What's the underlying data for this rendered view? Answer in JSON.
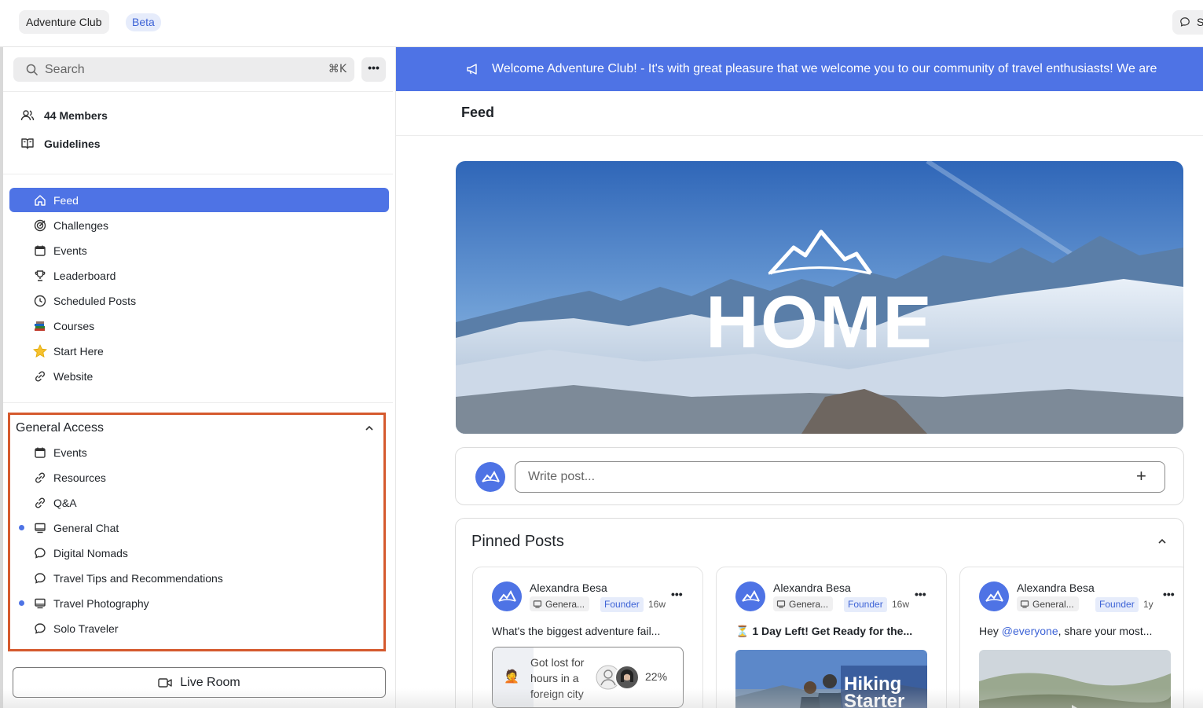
{
  "topbar": {
    "app_name": "Adventure Club",
    "badge": "Beta",
    "right_button_label": "S"
  },
  "sidebar": {
    "search_placeholder": "Search",
    "search_shortcut": "⌘K",
    "members": "44 Members",
    "guidelines": "Guidelines",
    "nav": [
      {
        "label": "Feed",
        "icon": "home-icon"
      },
      {
        "label": "Challenges",
        "icon": "target-icon"
      },
      {
        "label": "Events",
        "icon": "calendar-icon"
      },
      {
        "label": "Leaderboard",
        "icon": "trophy-icon"
      },
      {
        "label": "Scheduled Posts",
        "icon": "clock-icon"
      },
      {
        "label": "Courses",
        "icon": "books-emoji-icon"
      },
      {
        "label": "Start Here",
        "icon": "star-emoji-icon"
      },
      {
        "label": "Website",
        "icon": "link-icon"
      }
    ],
    "section": {
      "title": "General Access",
      "items": [
        {
          "label": "Events",
          "icon": "calendar-icon"
        },
        {
          "label": "Resources",
          "icon": "link-icon"
        },
        {
          "label": "Q&A",
          "icon": "link-icon"
        },
        {
          "label": "General Chat",
          "icon": "monitor-icon",
          "unread": true
        },
        {
          "label": "Digital Nomads",
          "icon": "chat-bubble-icon"
        },
        {
          "label": "Travel Tips and Recommendations",
          "icon": "chat-bubble-icon"
        },
        {
          "label": "Travel Photography",
          "icon": "monitor-icon",
          "unread": true
        },
        {
          "label": "Solo Traveler",
          "icon": "chat-bubble-icon"
        }
      ]
    },
    "live_room": "Live Room"
  },
  "main": {
    "banner": "Welcome Adventure Club! - It's with great pleasure that we welcome you to our community of travel enthusiasts! We are",
    "feed_title": "Feed",
    "hero_text": "HOME",
    "composer_placeholder": "Write post...",
    "composer_plus": "+",
    "pinned": {
      "title": "Pinned Posts",
      "cards": [
        {
          "author": "Alexandra Besa",
          "channel": "Genera...",
          "role": "Founder",
          "time": "16w",
          "excerpt": "What's the biggest adventure fail...",
          "poll_emoji": "🤦",
          "poll_text": "Got lost for hours in a foreign city",
          "poll_percent": "22%"
        },
        {
          "author": "Alexandra Besa",
          "channel": "Genera...",
          "role": "Founder",
          "time": "16w",
          "excerpt": "⏳ 1 Day Left! Get Ready for the...",
          "thumb_text": "Hiking Starter"
        },
        {
          "author": "Alexandra Besa",
          "channel": "General...",
          "role": "Founder",
          "time": "1y",
          "excerpt_prefix": "Hey ",
          "excerpt_mention": "@everyone",
          "excerpt_suffix": ", share your most..."
        }
      ]
    }
  },
  "colors": {
    "accent": "#4e73e5",
    "highlight_border": "#d55a2e",
    "badge_bg": "#e6ecfb",
    "badge_text": "#3d63d6"
  }
}
